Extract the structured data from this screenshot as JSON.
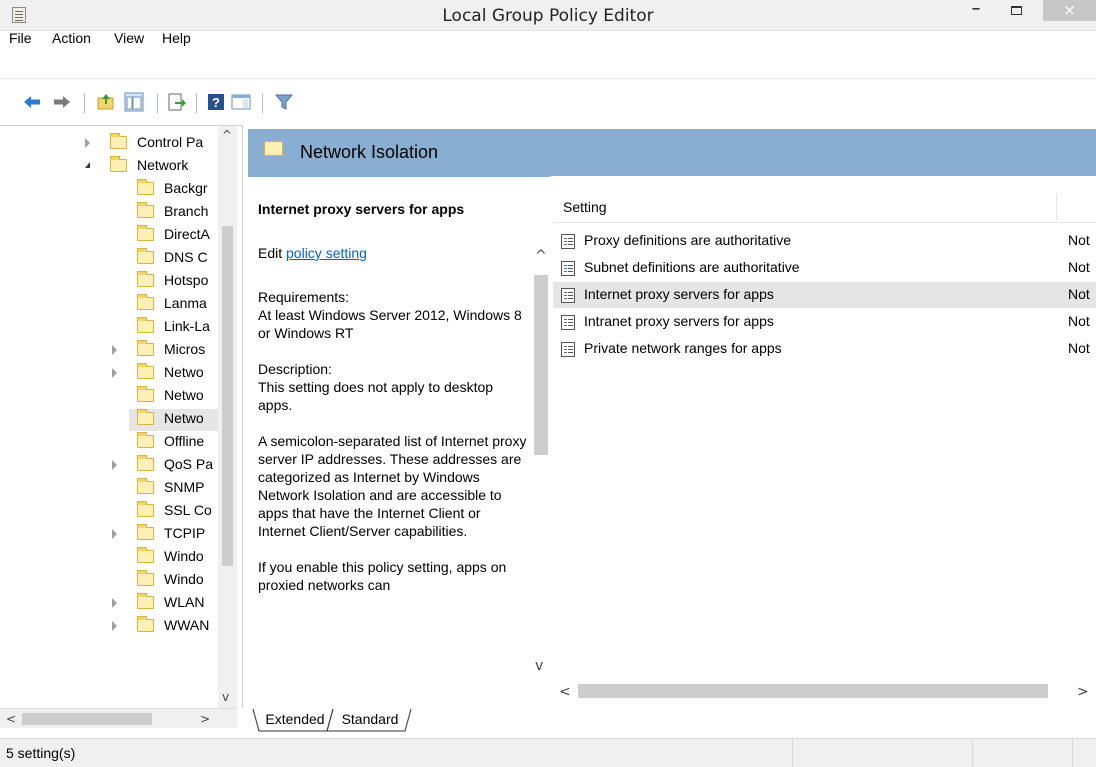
{
  "window": {
    "title": "Local Group Policy Editor",
    "controls": {
      "minimize": "–",
      "maximize": "",
      "close": "×"
    }
  },
  "menu": {
    "items": [
      "File",
      "Action",
      "View",
      "Help"
    ]
  },
  "toolbar": {
    "icons": [
      "back-arrow-icon",
      "forward-arrow-icon",
      "up-folder-icon",
      "show-hide-tree-icon",
      "export-list-icon",
      "help-icon",
      "action-pane-icon",
      "filter-icon"
    ]
  },
  "tree": {
    "nodes": [
      {
        "label": "Control Pa",
        "expander": "collapsed"
      },
      {
        "label": "Network",
        "expander": "expanded"
      },
      {
        "label": "Backgr",
        "expander": "none"
      },
      {
        "label": "Branch",
        "expander": "none"
      },
      {
        "label": "DirectA",
        "expander": "none"
      },
      {
        "label": "DNS C",
        "expander": "none"
      },
      {
        "label": "Hotspo",
        "expander": "none"
      },
      {
        "label": "Lanma",
        "expander": "none"
      },
      {
        "label": "Link-La",
        "expander": "none"
      },
      {
        "label": "Micros",
        "expander": "collapsed"
      },
      {
        "label": "Netwo",
        "expander": "collapsed"
      },
      {
        "label": "Netwo",
        "expander": "none"
      },
      {
        "label": "Netwo",
        "expander": "none",
        "selected": true
      },
      {
        "label": "Offline",
        "expander": "none"
      },
      {
        "label": "QoS Pa",
        "expander": "collapsed"
      },
      {
        "label": "SNMP",
        "expander": "none"
      },
      {
        "label": "SSL Co",
        "expander": "none"
      },
      {
        "label": "TCPIP",
        "expander": "collapsed"
      },
      {
        "label": "Windo",
        "expander": "none"
      },
      {
        "label": "Windo",
        "expander": "none"
      },
      {
        "label": "WLAN",
        "expander": "collapsed"
      },
      {
        "label": "WWAN",
        "expander": "collapsed"
      }
    ]
  },
  "header": {
    "title": "Network Isolation"
  },
  "description": {
    "title": "Internet proxy servers for apps",
    "edit_prefix": "Edit ",
    "edit_link": "policy setting ",
    "requirements_label": "Requirements:",
    "requirements_text": "At least Windows Server 2012, Windows 8 or Windows RT",
    "description_label": "Description:",
    "description_text": " This setting does not apply to desktop apps.",
    "para1": "A semicolon-separated list of Internet proxy server IP addresses. These addresses are categorized as Internet by Windows Network Isolation and are accessible to apps that have the Internet Client or Internet Client/Server capabilities.",
    "para2": "If you enable this policy setting, apps on proxied networks can"
  },
  "list": {
    "column_setting": "Setting",
    "rows": [
      {
        "name": "Proxy definitions are authoritative",
        "state": "Not"
      },
      {
        "name": "Subnet definitions are authoritative",
        "state": "Not"
      },
      {
        "name": "Internet proxy servers for apps",
        "state": "Not",
        "highlighted": true
      },
      {
        "name": "Intranet proxy servers for  apps",
        "state": "Not"
      },
      {
        "name": "Private network ranges for  apps",
        "state": "Not"
      }
    ]
  },
  "tabs": {
    "extended": "Extended",
    "standard": "Standard"
  },
  "status": {
    "text": "5 setting(s)"
  }
}
